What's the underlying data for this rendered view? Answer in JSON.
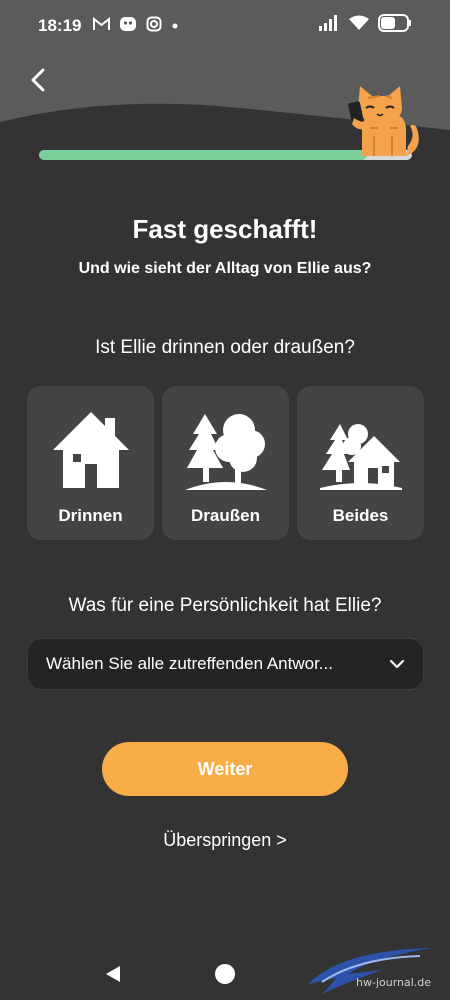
{
  "status_bar": {
    "time": "18:19",
    "left_icons": [
      "gmail-icon",
      "app-icon",
      "instagram-icon",
      "dot-icon"
    ],
    "right_icons": [
      "signal-icon",
      "wifi-icon",
      "battery-icon"
    ]
  },
  "header": {
    "progress": 0.88,
    "mascot": "cat-with-phone-icon"
  },
  "main": {
    "title": "Fast geschafft!",
    "subtitle": "Und wie sieht der Alltag von Ellie aus?",
    "question_environment": "Ist Ellie drinnen oder draußen?",
    "options": [
      {
        "label": "Drinnen",
        "icon": "house-icon"
      },
      {
        "label": "Draußen",
        "icon": "trees-icon"
      },
      {
        "label": "Beides",
        "icon": "house-trees-icon"
      }
    ],
    "question_personality": "Was für eine Persönlichkeit hat Ellie?",
    "personality_select": {
      "value": "Wählen Sie alle zutreffenden Antwor..."
    },
    "continue_label": "Weiter",
    "skip_label": "Überspringen >"
  },
  "watermark": {
    "text": "hw-journal.de"
  },
  "colors": {
    "background": "#333333",
    "progress": "#7ccf9c",
    "accent": "#f9ad48",
    "card": "#444444"
  }
}
